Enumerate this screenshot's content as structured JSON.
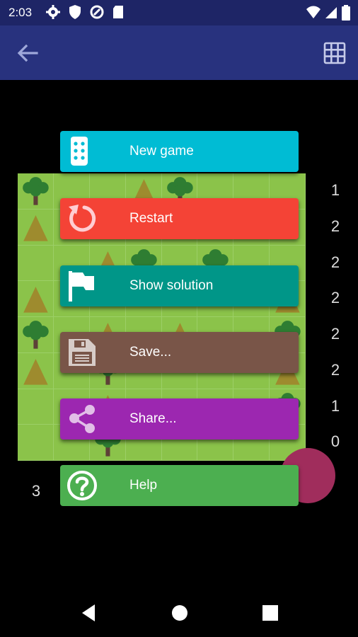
{
  "status_bar": {
    "time": "2:03"
  },
  "app_bar": {
    "back_icon": "arrow-back-icon",
    "grid_icon": "grid-icon"
  },
  "board": {
    "columns": 8,
    "rows": 8,
    "trees": [
      [
        0,
        0
      ],
      [
        0,
        4
      ],
      [
        2,
        3
      ],
      [
        2,
        5
      ],
      [
        4,
        0
      ],
      [
        4,
        7
      ],
      [
        5,
        2
      ],
      [
        6,
        7
      ],
      [
        7,
        2
      ]
    ],
    "tents": [
      [
        0,
        3
      ],
      [
        1,
        0
      ],
      [
        2,
        2
      ],
      [
        3,
        0
      ],
      [
        3,
        7
      ],
      [
        4,
        2
      ],
      [
        4,
        4
      ],
      [
        5,
        0
      ],
      [
        5,
        7
      ],
      [
        6,
        2
      ]
    ],
    "row_clues": [
      "1",
      "2",
      "2",
      "2",
      "2",
      "2",
      "1",
      "0"
    ],
    "col_clue_visible": "3",
    "colors": {
      "grass": "#8bc34a",
      "tree": "#2e7d32",
      "trunk": "#5d4037",
      "tent": "#9e8b2e"
    }
  },
  "menu": {
    "items": [
      {
        "label": "New game",
        "icon": "dice-icon",
        "color": "#00bcd4"
      },
      {
        "label": "Restart",
        "icon": "restart-icon",
        "color": "#f44336"
      },
      {
        "label": "Show solution",
        "icon": "flag-icon",
        "color": "#009688"
      },
      {
        "label": "Save...",
        "icon": "floppy-disk-icon",
        "color": "#795548"
      },
      {
        "label": "Share...",
        "icon": "share-icon",
        "color": "#9c27b0"
      },
      {
        "label": "Help",
        "icon": "help-circle-icon",
        "color": "#4caf50"
      }
    ]
  },
  "fab": {
    "color": "#a02d5c"
  },
  "nav_bar": {
    "back": "nav-back-icon",
    "home": "nav-home-icon",
    "recents": "nav-recents-icon"
  }
}
